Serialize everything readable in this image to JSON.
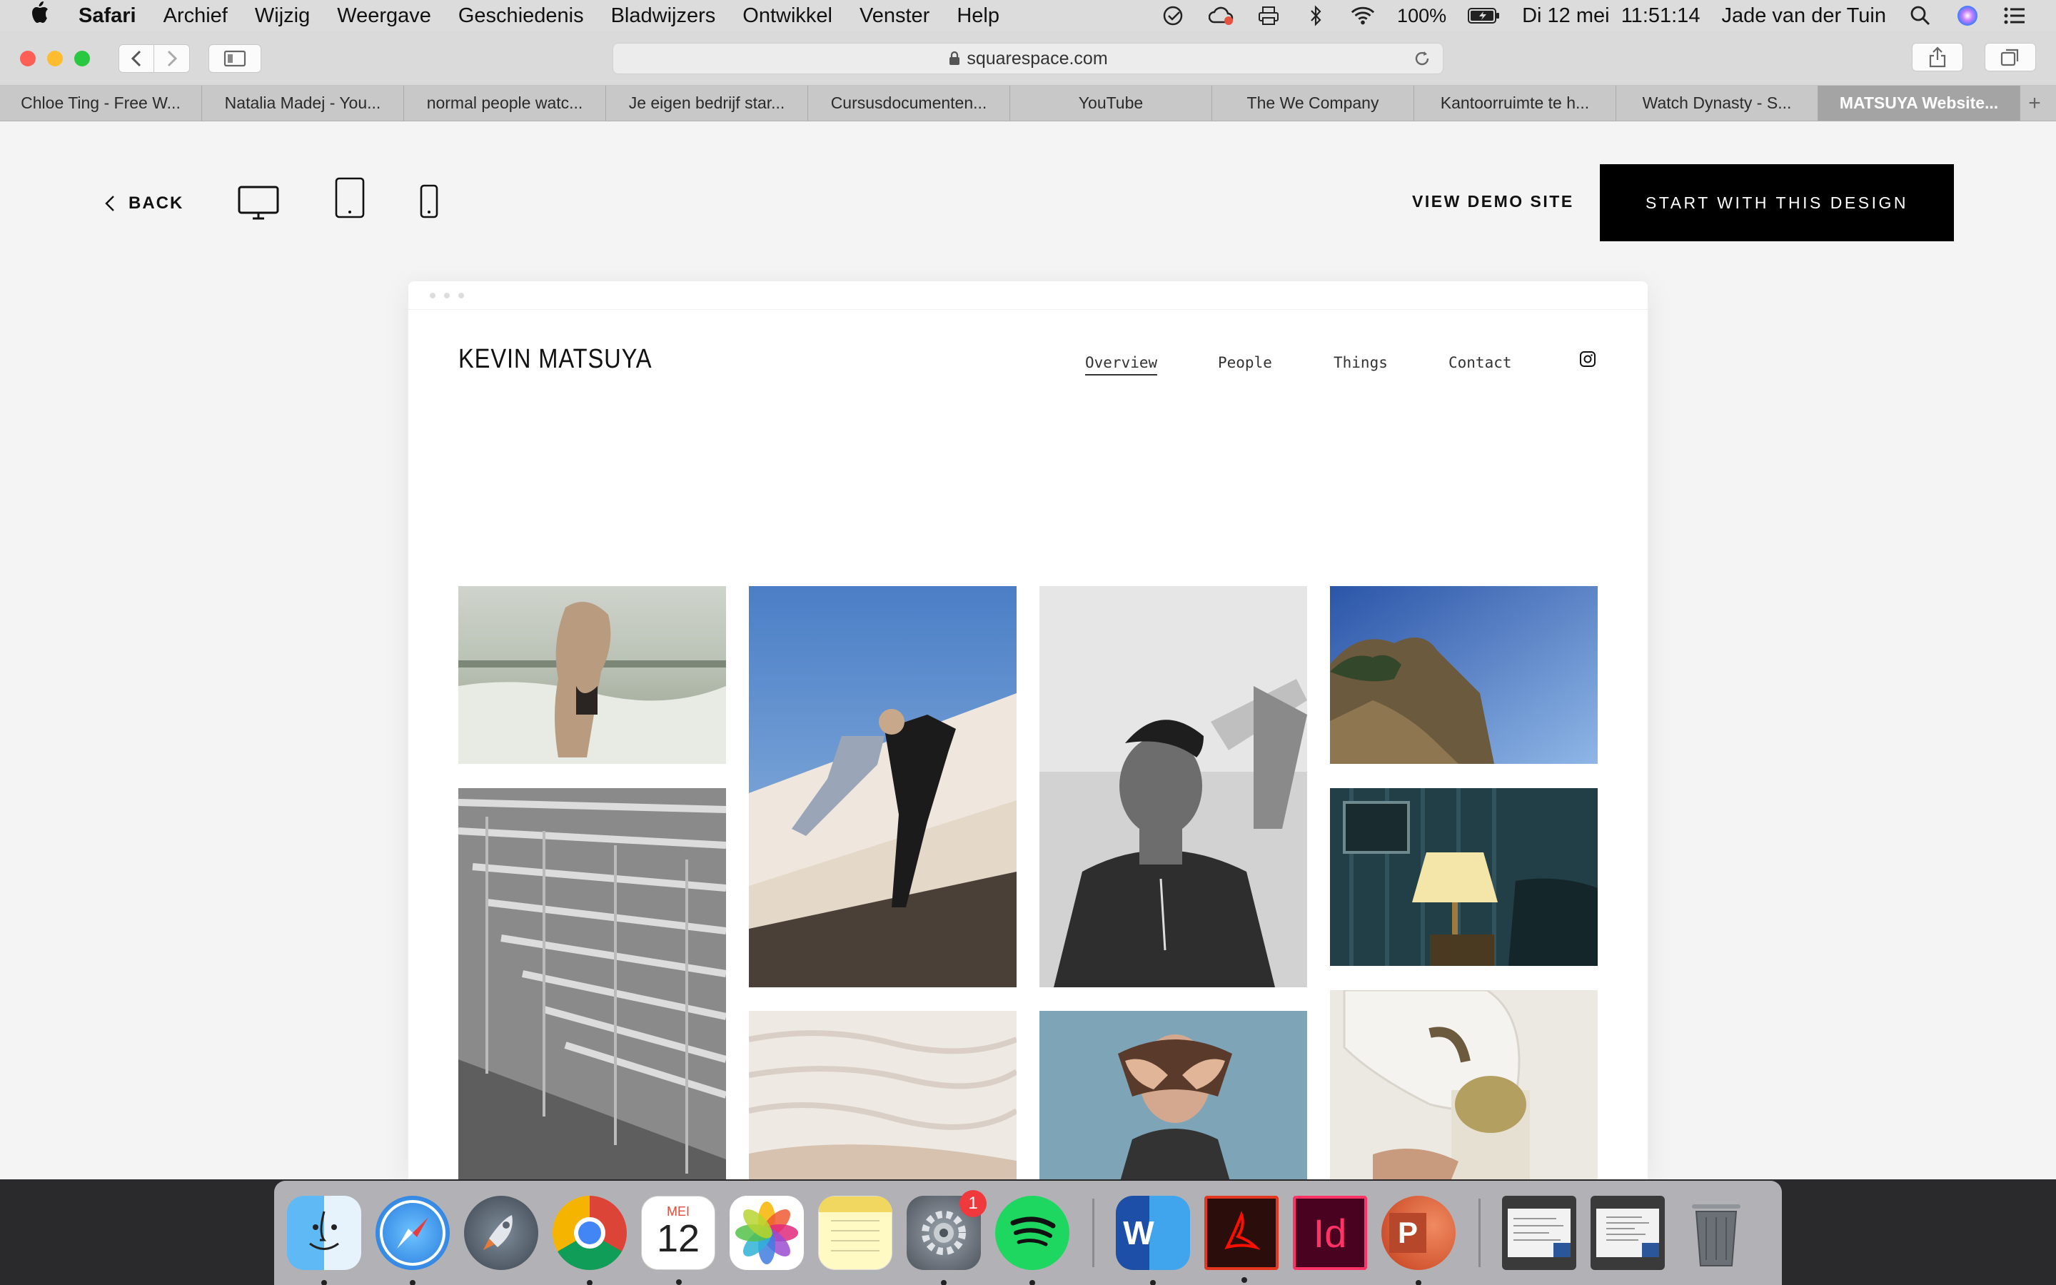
{
  "menubar": {
    "app_name": "Safari",
    "items": [
      "Archief",
      "Wijzig",
      "Weergave",
      "Geschiedenis",
      "Bladwijzers",
      "Ontwikkel",
      "Venster",
      "Help"
    ],
    "battery": "100%",
    "datetime": "Di 12 mei  11:51:14",
    "user": "Jade van der Tuin"
  },
  "browser": {
    "url": "squarespace.com",
    "tabs": [
      "Chloe Ting - Free W...",
      "Natalia Madej - You...",
      "normal people watc...",
      "Je eigen bedrijf star...",
      "Cursusdocumenten...",
      "YouTube",
      "The We Company",
      "Kantoorruimte te h...",
      "Watch Dynasty - S...",
      "MATSUYA Website..."
    ],
    "active_tab_index": 9
  },
  "preview_bar": {
    "back_label": "BACK",
    "demo_label": "VIEW DEMO SITE",
    "start_label": "START WITH THIS DESIGN",
    "devices": [
      "desktop-icon",
      "tablet-icon",
      "phone-icon"
    ]
  },
  "site": {
    "title": "KEVIN MATSUYA",
    "nav": [
      "Overview",
      "People",
      "Things",
      "Contact"
    ],
    "active_nav": "Overview",
    "photos": [
      "woman-splashing-in-waves",
      "grey-bleachers",
      "cut-off-sky-photo",
      "men-climbing-white-wall",
      "white-travertine-terraces",
      "man-pouring-water-bottle",
      "woman-covering-eyes",
      "cut-off-photo",
      "rocky-cliff-blue-sky",
      "table-lamp-in-blue-room",
      "hands-pouring-tea"
    ]
  },
  "dock": {
    "apps": [
      "finder-icon",
      "safari-icon",
      "launchpad-icon",
      "chrome-icon",
      "calendar-icon",
      "photos-icon",
      "notes-icon",
      "system-preferences-icon",
      "spotify-icon",
      "word-icon",
      "acrobat-icon",
      "indesign-icon",
      "powerpoint-icon",
      "word-document-1",
      "word-document-2",
      "trash-icon"
    ],
    "calendar_month": "MEI",
    "calendar_day": "12",
    "system_prefs_badge": "1",
    "word_letter": "W",
    "indesign_letters": "Id",
    "powerpoint_letter": "P"
  },
  "colors": {
    "accent_black": "#000000",
    "menubar_bg": "#dcdcdc",
    "page_bg": "#f4f4f4"
  }
}
